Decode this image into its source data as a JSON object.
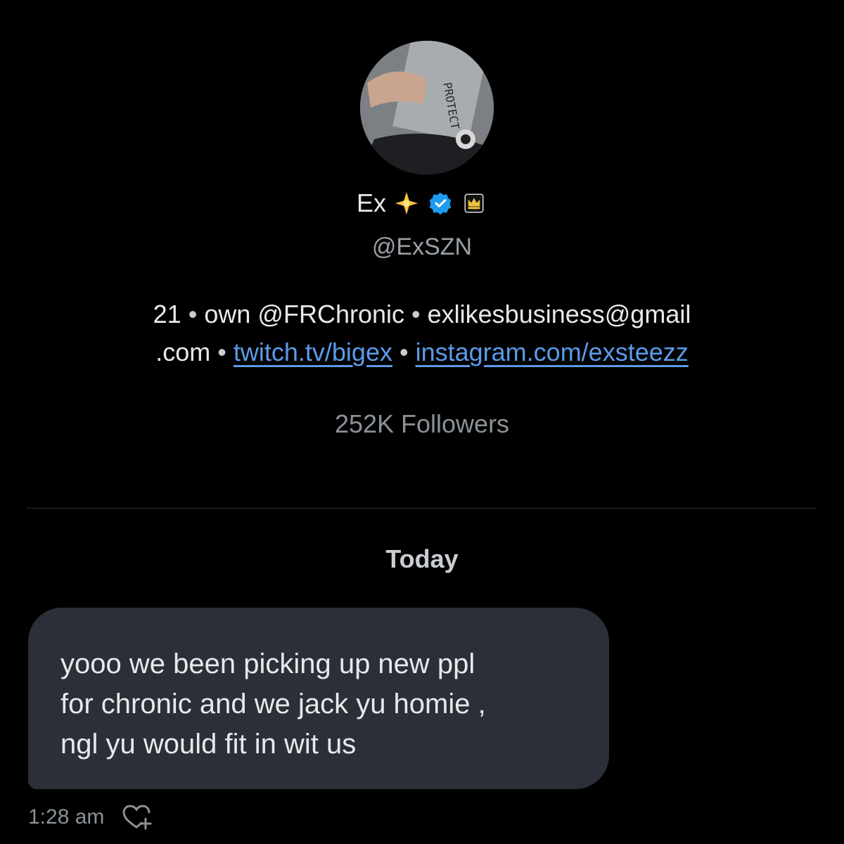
{
  "profile": {
    "display_name": "Ex",
    "badges": [
      {
        "icon": "sparkle-star-icon"
      },
      {
        "icon": "verified-badge-icon",
        "color": "#1d9bf0"
      },
      {
        "icon": "affiliate-crown-icon"
      }
    ],
    "handle": "@ExSZN",
    "bio": {
      "age": "21",
      "own_prefix": "own",
      "own_mention": "@FRChronic",
      "email": "exlikesbusiness@gmail.com",
      "email_line1": "exlikesbusiness@gmail",
      "email_line2": ".com",
      "links": [
        "twitch.tv/bigex",
        "instagram.com/exsteezz"
      ],
      "separator": "•"
    },
    "followers": "252K Followers"
  },
  "conversation": {
    "date_label": "Today",
    "messages": [
      {
        "text": "yooo we been picking up new ppl\nfor chronic and we jack yu homie ,\nngl yu would fit in wit us",
        "time": "1:28 am",
        "react_icon": "add-reaction-heart-icon"
      }
    ]
  },
  "colors": {
    "background": "#000000",
    "bubble": "#2a2f38",
    "link": "#5b9bea",
    "muted": "#8b9196"
  }
}
